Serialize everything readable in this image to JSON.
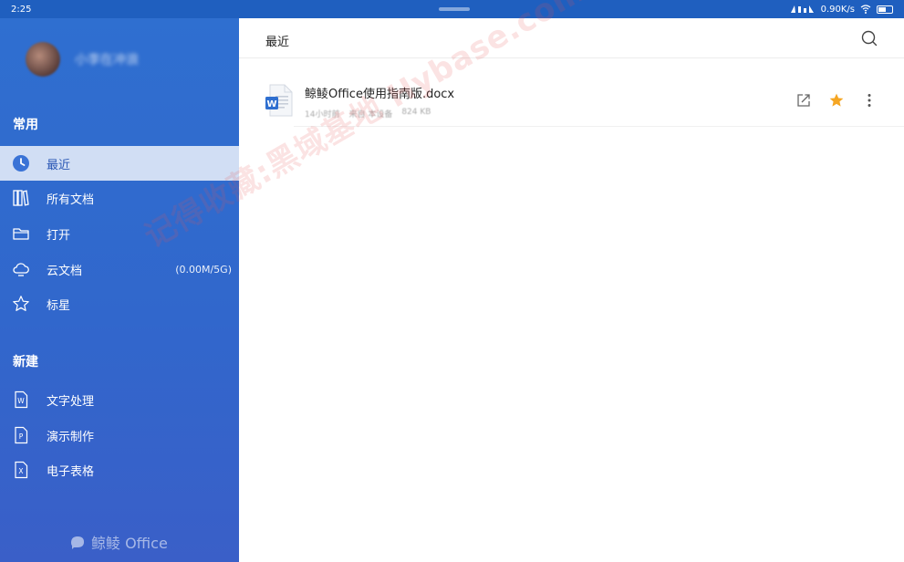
{
  "status_bar": {
    "time": "2:25",
    "speed": "0.90K/s"
  },
  "profile": {
    "username": "小李在冲浪"
  },
  "sidebar": {
    "section_common": "常用",
    "items": [
      {
        "label": "最近",
        "icon": "clock-icon",
        "active": true
      },
      {
        "label": "所有文档",
        "icon": "library-icon"
      },
      {
        "label": "打开",
        "icon": "folder-icon"
      },
      {
        "label": "云文档",
        "icon": "cloud-icon",
        "extra": "(0.00M/5G)"
      },
      {
        "label": "标星",
        "icon": "star-icon"
      }
    ],
    "section_new": "新建",
    "new_items": [
      {
        "label": "文字处理",
        "icon": "word-doc-icon",
        "letter": "W"
      },
      {
        "label": "演示制作",
        "icon": "presentation-doc-icon",
        "letter": "P"
      },
      {
        "label": "电子表格",
        "icon": "spreadsheet-doc-icon",
        "letter": "X"
      }
    ],
    "brand": "鲸鲮 Office"
  },
  "main": {
    "title": "最近",
    "files": [
      {
        "name": "鲸鲮Office使用指南版.docx",
        "time": "14小时前",
        "source": "来自 本设备",
        "size": "824 KB",
        "starred": true
      }
    ]
  },
  "watermark": "记得收藏:黑域基地 Hybase.com",
  "colors": {
    "sidebar": "#3167cc",
    "accent": "#1f5fbf",
    "star": "#f5a623"
  }
}
